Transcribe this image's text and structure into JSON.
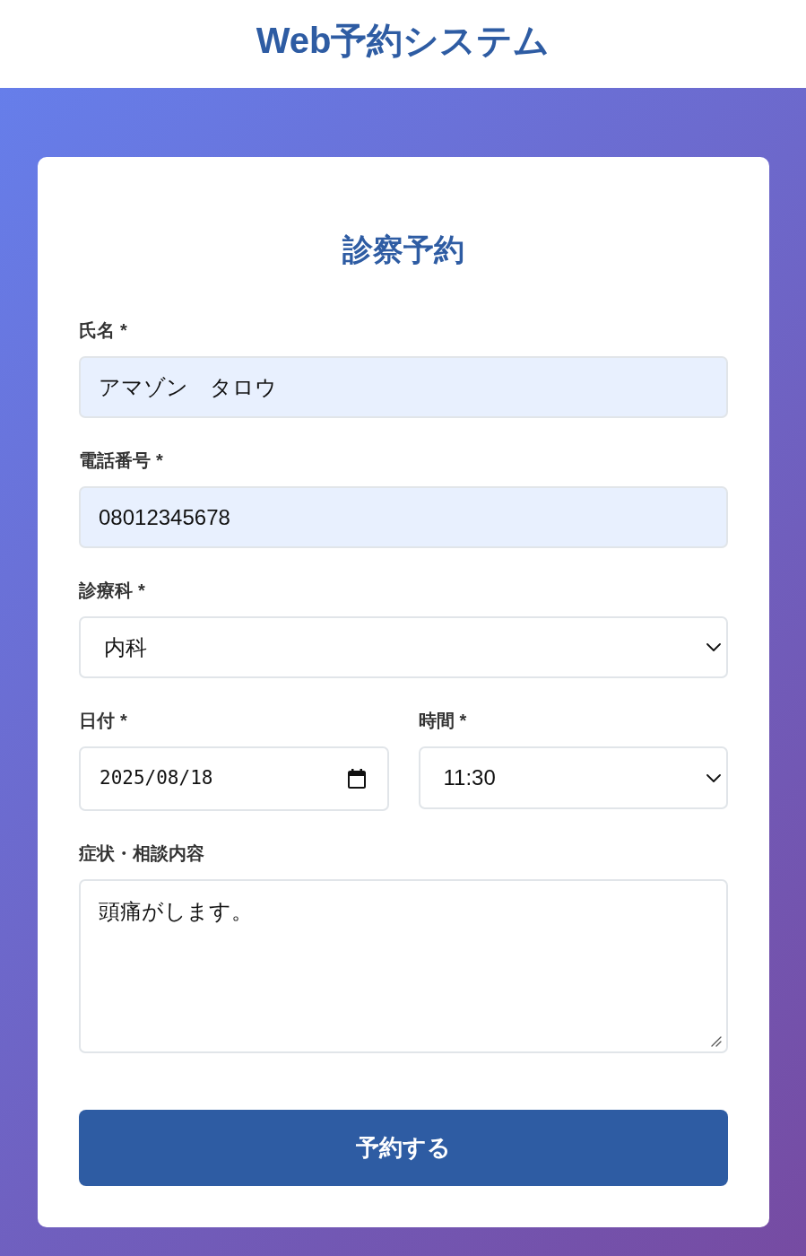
{
  "header": {
    "title": "Web予約システム"
  },
  "form": {
    "title": "診察予約",
    "rows": [
      {
        "fields": [
          {
            "kind": "text",
            "label": "氏名",
            "required_mark": "*",
            "value": "アマゾン　タロウ",
            "autofilled": true
          }
        ]
      },
      {
        "fields": [
          {
            "kind": "text",
            "label": "電話番号",
            "required_mark": "*",
            "value": "08012345678",
            "autofilled": true
          }
        ]
      },
      {
        "fields": [
          {
            "kind": "select",
            "label": "診療科",
            "required_mark": "*",
            "value": "内科",
            "autofilled": false
          }
        ]
      },
      {
        "fields": [
          {
            "kind": "date",
            "label": "日付",
            "required_mark": "*",
            "value": "2025/08/18",
            "autofilled": false
          },
          {
            "kind": "select",
            "label": "時間",
            "required_mark": "*",
            "value": "11:30",
            "autofilled": false
          }
        ]
      },
      {
        "fields": [
          {
            "kind": "textarea",
            "label": "症状・相談内容",
            "value": "頭痛がします。",
            "autofilled": false
          }
        ]
      }
    ],
    "submit_button": {
      "label": "予約する"
    }
  }
}
